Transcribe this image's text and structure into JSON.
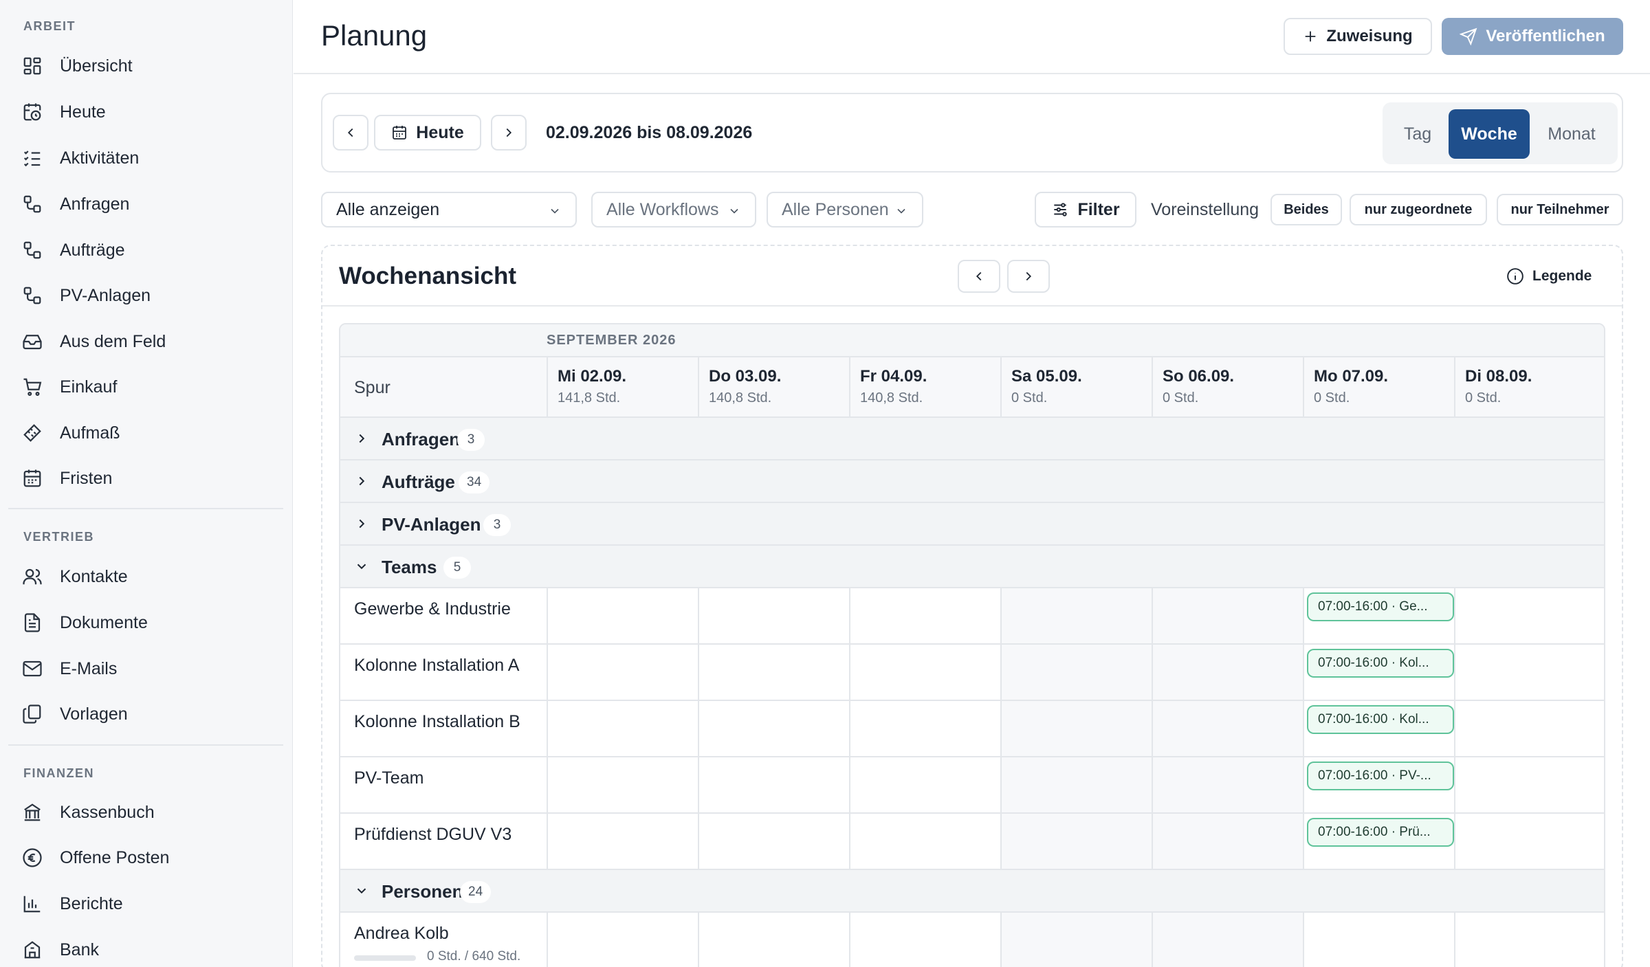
{
  "sidebar": {
    "sections": [
      {
        "title": "ARBEIT",
        "items": [
          {
            "label": "Übersicht",
            "icon": "dashboard-icon"
          },
          {
            "label": "Heute",
            "icon": "calendar-clock-icon"
          },
          {
            "label": "Aktivitäten",
            "icon": "checklist-icon"
          },
          {
            "label": "Anfragen",
            "icon": "workflow-icon"
          },
          {
            "label": "Aufträge",
            "icon": "workflow-icon"
          },
          {
            "label": "PV-Anlagen",
            "icon": "workflow-icon"
          },
          {
            "label": "Aus dem Feld",
            "icon": "inbox-icon"
          },
          {
            "label": "Einkauf",
            "icon": "cart-icon"
          },
          {
            "label": "Aufmaß",
            "icon": "ruler-icon"
          },
          {
            "label": "Fristen",
            "icon": "calendar-icon"
          }
        ]
      },
      {
        "title": "VERTRIEB",
        "items": [
          {
            "label": "Kontakte",
            "icon": "users-icon"
          },
          {
            "label": "Dokumente",
            "icon": "document-icon"
          },
          {
            "label": "E-Mails",
            "icon": "mail-icon"
          },
          {
            "label": "Vorlagen",
            "icon": "copy-icon"
          }
        ]
      },
      {
        "title": "FINANZEN",
        "items": [
          {
            "label": "Kassenbuch",
            "icon": "bank-icon"
          },
          {
            "label": "Offene Posten",
            "icon": "euro-icon"
          },
          {
            "label": "Berichte",
            "icon": "bar-chart-icon"
          },
          {
            "label": "Bank",
            "icon": "building-icon"
          }
        ]
      }
    ]
  },
  "header": {
    "title": "Planung",
    "assign_label": "Zuweisung",
    "publish_label": "Veröffentlichen"
  },
  "toolbar": {
    "today_label": "Heute",
    "date_range": "02.09.2026 bis 08.09.2026",
    "views": [
      {
        "label": "Tag",
        "active": false
      },
      {
        "label": "Woche",
        "active": true
      },
      {
        "label": "Monat",
        "active": false
      }
    ]
  },
  "filters": {
    "show": "Alle anzeigen",
    "workflows": "Alle Workflows",
    "persons": "Alle Personen",
    "filter_label": "Filter",
    "preset_label": "Voreinstellung",
    "presets": [
      "Beides",
      "nur zugeordnete",
      "nur Teilnehmer"
    ]
  },
  "week": {
    "title": "Wochenansicht",
    "legend_label": "Legende",
    "month_label": "SEPTEMBER 2026",
    "lane_header": "Spur",
    "days": [
      {
        "name": "Mi 02.09.",
        "hours": "141,8 Std.",
        "weekend": false
      },
      {
        "name": "Do 03.09.",
        "hours": "140,8 Std.",
        "weekend": false
      },
      {
        "name": "Fr 04.09.",
        "hours": "140,8 Std.",
        "weekend": false
      },
      {
        "name": "Sa 05.09.",
        "hours": "0 Std.",
        "weekend": true
      },
      {
        "name": "So 06.09.",
        "hours": "0 Std.",
        "weekend": true
      },
      {
        "name": "Mo 07.09.",
        "hours": "0 Std.",
        "weekend": false
      },
      {
        "name": "Di 08.09.",
        "hours": "0 Std.",
        "weekend": false
      }
    ],
    "groups": [
      {
        "label": "Anfragen",
        "count": "3",
        "expanded": false
      },
      {
        "label": "Aufträge",
        "count": "34",
        "expanded": false
      },
      {
        "label": "PV-Anlagen",
        "count": "3",
        "expanded": false
      },
      {
        "label": "Teams",
        "count": "5",
        "expanded": true
      },
      {
        "label": "Personen",
        "count": "24",
        "expanded": true
      }
    ],
    "teams": [
      {
        "name": "Gewerbe & Industrie",
        "event": "07:00-16:00 · Ge..."
      },
      {
        "name": "Kolonne Installation A",
        "event": "07:00-16:00 · Kol..."
      },
      {
        "name": "Kolonne Installation B",
        "event": "07:00-16:00 · Kol..."
      },
      {
        "name": "PV-Team",
        "event": "07:00-16:00 · PV-..."
      },
      {
        "name": "Prüfdienst DGUV V3",
        "event": "07:00-16:00 · Prü..."
      }
    ],
    "persons": [
      {
        "name": "Andrea Kolb",
        "hours": "0 Std. / 640 Std.",
        "utilization": 0
      }
    ]
  },
  "colors": {
    "accent": "#1f4f8c",
    "publish_disabled": "#8ba5c6",
    "event_border": "#5fc39a",
    "event_bg": "#eefaf4"
  }
}
